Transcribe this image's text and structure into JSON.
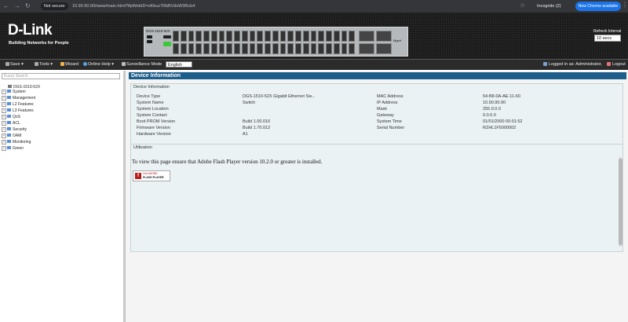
{
  "browser": {
    "security": "Not secure",
    "url": "10.90.90.90/www/main.html?ifpWebID=oKkuz7RbBVdxW3Rcb4",
    "incognito": "Incognito (2)",
    "new_chrome": "New Chrome available"
  },
  "header": {
    "brand": "D-Link",
    "tagline": "Building Networks for People",
    "device_model_label": "DGS-1510-52X",
    "mgmt_label": "Mgmt",
    "refresh_label": "Refresh Interval",
    "refresh_value": "10 secs"
  },
  "toolbar": {
    "save": "Save",
    "tools": "Tools",
    "wizard": "Wizard",
    "online_help": "Online Help",
    "surveillance": "Surveillance Mode",
    "language": "English",
    "logged_in": "Logged in as: Administrator,",
    "logout": "Logout"
  },
  "sidebar": {
    "search_placeholder": "Fuzzy Search",
    "root": "DGS-1510-52X",
    "items": [
      {
        "label": "System"
      },
      {
        "label": "Management"
      },
      {
        "label": "L2 Features"
      },
      {
        "label": "L3 Features"
      },
      {
        "label": "QoS"
      },
      {
        "label": "ACL"
      },
      {
        "label": "Security"
      },
      {
        "label": "OAM"
      },
      {
        "label": "Monitoring"
      },
      {
        "label": "Green"
      }
    ]
  },
  "main": {
    "title": "Device Information",
    "device_info": {
      "section_title": "Device Information",
      "left": [
        {
          "label": "Device Type",
          "value": "DGS-1510-52X Gigabit Ethernet Sw..."
        },
        {
          "label": "System Name",
          "value": "Switch"
        },
        {
          "label": "System Location",
          "value": ""
        },
        {
          "label": "System Contact",
          "value": ""
        },
        {
          "label": "Boot PROM Version",
          "value": "Build 1.00.016"
        },
        {
          "label": "Firmware Version",
          "value": "Build 1.70.012"
        },
        {
          "label": "Hardware Version",
          "value": "A1"
        }
      ],
      "right": [
        {
          "label": "MAC Address",
          "value": "54-B8-0A-AE-11-60"
        },
        {
          "label": "IP Address",
          "value": "10.90.90.90"
        },
        {
          "label": "Mask",
          "value": "255.0.0.0"
        },
        {
          "label": "Gateway",
          "value": "0.0.0.0"
        },
        {
          "label": "System Time",
          "value": "01/01/2000 00:01:52"
        },
        {
          "label": "Serial Number",
          "value": "RZHL1F5000002"
        }
      ]
    },
    "utilization": {
      "section_title": "Utilization",
      "message": "To view this page ensure that Adobe Flash Player version 10.2.0 or greater is installed.",
      "badge_line1": "Get ADOBE",
      "badge_line2": "FLASH PLAYER"
    }
  }
}
